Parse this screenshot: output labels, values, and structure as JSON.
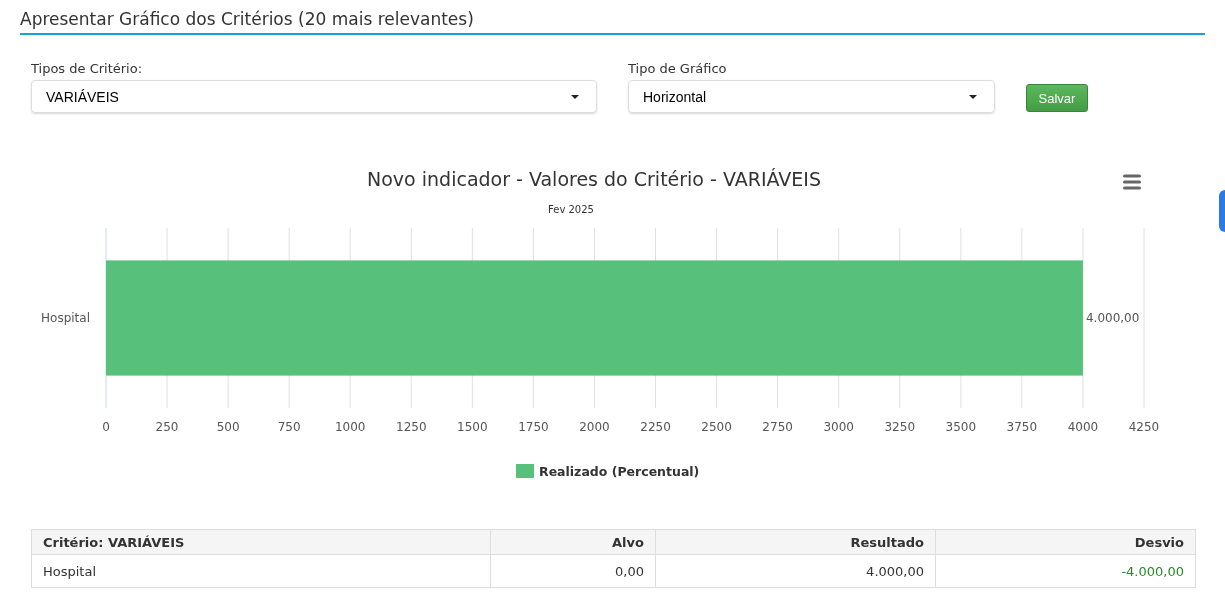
{
  "header": {
    "title": "Apresentar Gráfico dos Critérios (20 mais relevantes)"
  },
  "filters": [
    {
      "label": "Tipos de Critério:",
      "value": "VARIÁVEIS",
      "kind": "wide"
    },
    {
      "label": "Tipo de Gráfico",
      "value": "Horizontal",
      "kind": "narrow"
    }
  ],
  "save_button": "Salvar",
  "chart": {
    "subtitle": "Fev 2025",
    "chart_data": {
      "type": "bar",
      "orientation": "horizontal",
      "title": "Novo indicador - Valores do Critério - VARIÁVEIS",
      "categories": [
        "Hospital"
      ],
      "series": [
        {
          "name": "Realizado (Percentual)",
          "color": "#57c17b",
          "values": [
            4000
          ]
        }
      ],
      "xlim": [
        0,
        4250
      ],
      "xticks": [
        0,
        250,
        500,
        750,
        1000,
        1250,
        1500,
        1750,
        2000,
        2250,
        2500,
        2750,
        3000,
        3250,
        3500,
        3750,
        4000,
        4250
      ],
      "value_labels": [
        "4.000,00"
      ],
      "grid": true
    }
  },
  "table": {
    "columns": [
      "Critério: VARIÁVEIS",
      "Alvo",
      "Resultado",
      "Desvio"
    ],
    "rows": [
      {
        "cells": [
          "Hospital",
          "0,00",
          "4.000,00",
          "-4.000,00"
        ]
      }
    ]
  }
}
